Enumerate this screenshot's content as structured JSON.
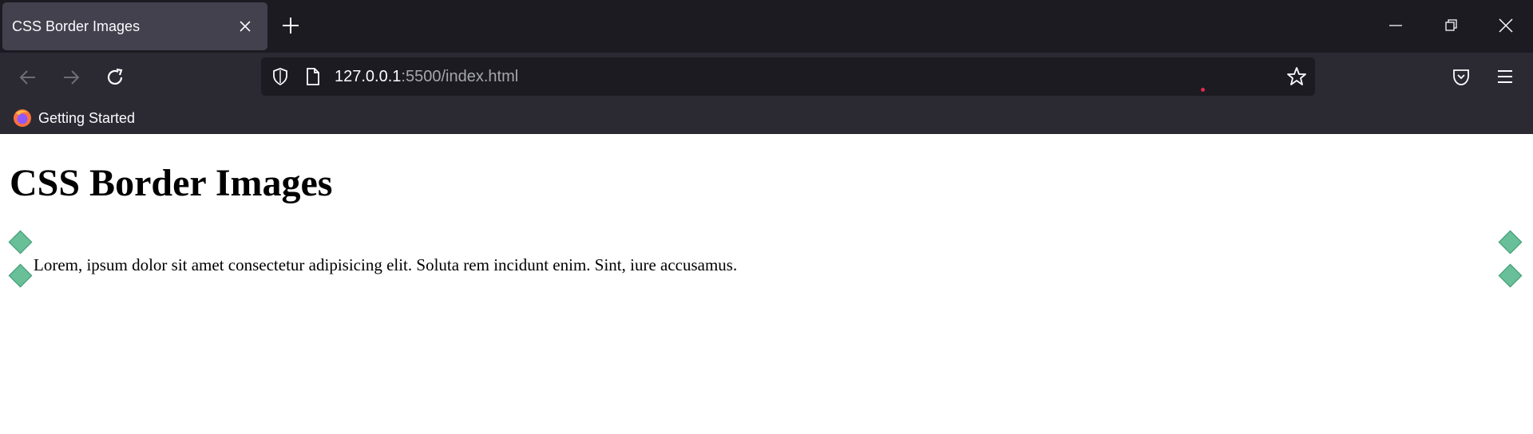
{
  "browser": {
    "tab": {
      "title": "CSS Border Images"
    },
    "address_bar": {
      "host": "127.0.0.1",
      "rest": ":5500/index.html"
    },
    "bookmarks": [
      {
        "label": "Getting Started"
      }
    ]
  },
  "page": {
    "heading": "CSS Border Images",
    "paragraph": "Lorem, ipsum dolor sit amet consectetur adipisicing elit. Soluta rem incidunt enim. Sint, iure accusamus."
  },
  "colors": {
    "diamond_fill": "#68bf98",
    "chrome": "#2b2a33",
    "tabstrip": "#1c1b22"
  }
}
